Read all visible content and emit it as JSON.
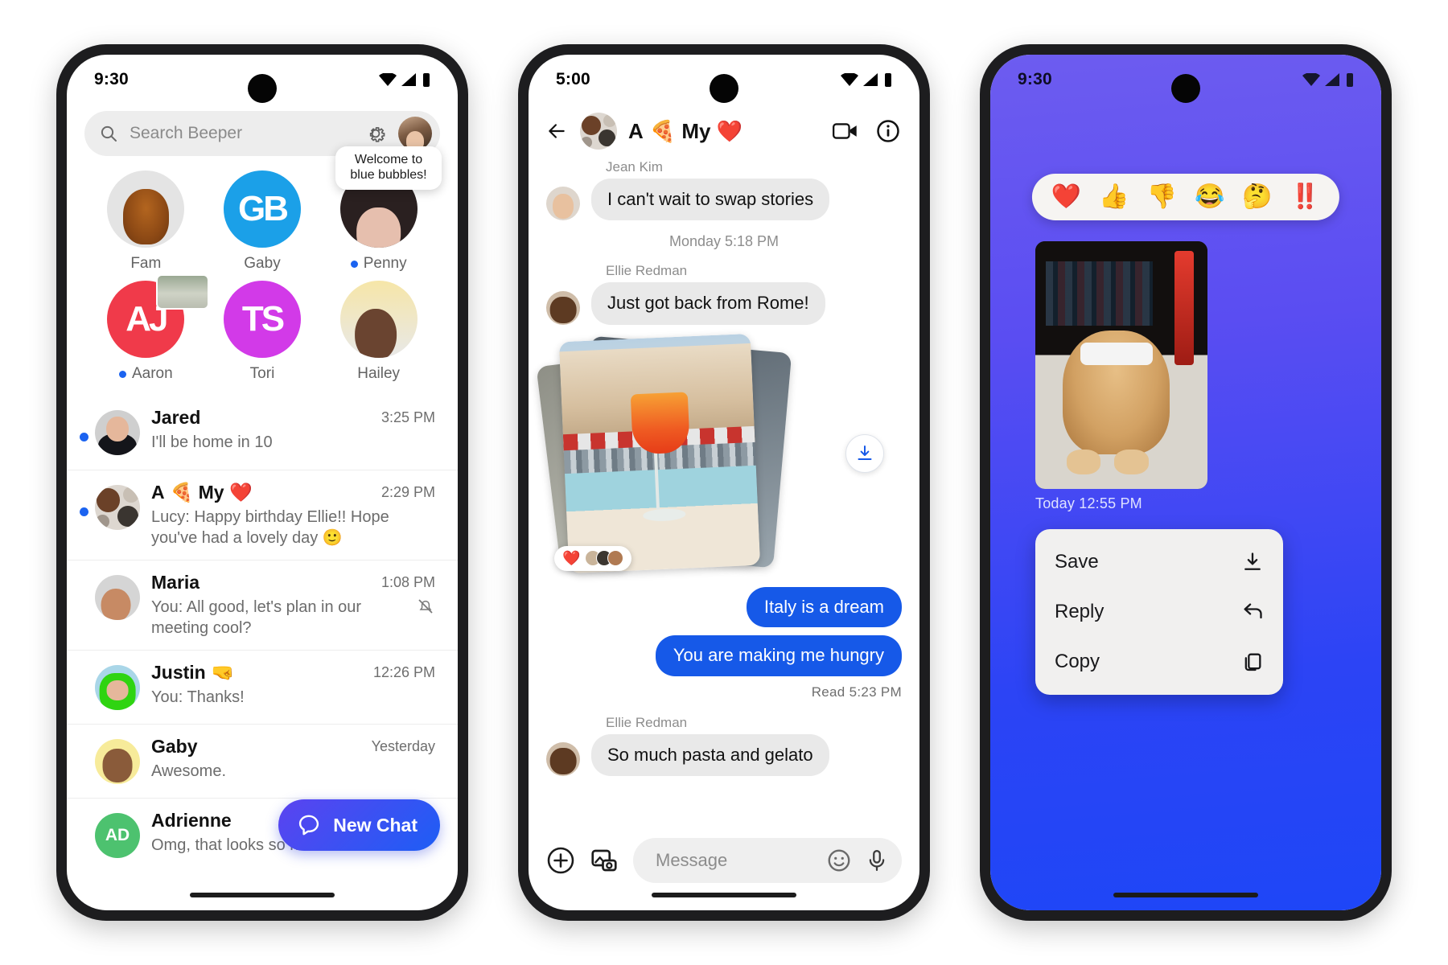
{
  "phone1": {
    "status": {
      "time": "9:30",
      "icons": [
        "wifi-icon",
        "cellular-icon",
        "battery-icon"
      ]
    },
    "search": {
      "placeholder": "Search Beeper",
      "gear_icon": "gear-icon",
      "avatar": "me-avatar"
    },
    "pinned": [
      {
        "label": "Fam",
        "unread": false,
        "kind": "photo"
      },
      {
        "label": "Gaby",
        "unread": false,
        "kind": "monogram",
        "monogram": "GB",
        "color": "#1ba0e8"
      },
      {
        "label": "Penny",
        "unread": true,
        "kind": "photo"
      },
      {
        "label": "Aaron",
        "unread": true,
        "kind": "monogram",
        "monogram": "AJ",
        "color": "#f03a4a"
      },
      {
        "label": "Tori",
        "unread": false,
        "kind": "monogram",
        "monogram": "TS",
        "color": "#d23ae8"
      },
      {
        "label": "Hailey",
        "unread": false,
        "kind": "photo"
      }
    ],
    "tooltip": "Welcome to blue bubbles!",
    "chats": [
      {
        "name": "Jared",
        "emoji": "",
        "time": "3:25 PM",
        "preview": "I'll be home in 10",
        "unread": true,
        "muted": false
      },
      {
        "name": "A",
        "emoji": "🍕 My ❤️",
        "time": "2:29 PM",
        "preview": "Lucy: Happy birthday Ellie!! Hope you've had a lovely day  🙂",
        "unread": true,
        "muted": false
      },
      {
        "name": "Maria",
        "emoji": "",
        "time": "1:08 PM",
        "preview": "You: All good, let's plan in our meeting cool?",
        "unread": false,
        "muted": true
      },
      {
        "name": "Justin",
        "emoji": "🤜",
        "time": "12:26 PM",
        "preview": "You: Thanks!",
        "unread": false,
        "muted": false
      },
      {
        "name": "Gaby",
        "emoji": "",
        "time": "Yesterday",
        "preview": "Awesome.",
        "unread": false,
        "muted": false
      },
      {
        "name": "Adrienne",
        "emoji": "",
        "time": "",
        "preview": "Omg, that looks so nice!",
        "unread": false,
        "muted": false,
        "initials": "AD"
      }
    ],
    "fab": {
      "label": "New Chat",
      "icon": "chat-bubble-icon"
    }
  },
  "phone2": {
    "status": {
      "time": "5:00"
    },
    "header": {
      "back_icon": "back-arrow-icon",
      "title": "A",
      "title_emoji": "🍕 My ❤️",
      "video_icon": "video-call-icon",
      "info_icon": "info-icon"
    },
    "messages": [
      {
        "type": "in",
        "sender": "Jean Kim",
        "text": "I can't wait to swap stories"
      },
      {
        "type": "divider",
        "text": "Monday 5:18 PM"
      },
      {
        "type": "in",
        "sender": "Ellie Redman",
        "text": "Just got back from Rome!"
      },
      {
        "type": "photos",
        "reaction": "❤️",
        "download_icon": "download-icon"
      },
      {
        "type": "out",
        "text": "Italy is a dream"
      },
      {
        "type": "out",
        "text": "You are making me hungry"
      },
      {
        "type": "receipt",
        "text": "Read  5:23 PM"
      },
      {
        "type": "in",
        "sender": "Ellie Redman",
        "text": "So much pasta and gelato"
      }
    ],
    "composer": {
      "plus_icon": "plus-circle-icon",
      "gallery_icon": "gallery-camera-icon",
      "placeholder": "Message",
      "emoji_icon": "emoji-icon",
      "mic_icon": "microphone-icon"
    }
  },
  "phone3": {
    "status": {
      "time": "9:30"
    },
    "background_color": "#3f47f5",
    "reactions": [
      "❤️",
      "👍",
      "👎",
      "😂",
      "🤔",
      "‼️"
    ],
    "media": {
      "timestamp": "Today  12:55 PM",
      "alt": "dog-with-sunglasses-photo"
    },
    "menu": [
      {
        "label": "Save",
        "icon": "download-icon"
      },
      {
        "label": "Reply",
        "icon": "reply-arrow-icon"
      },
      {
        "label": "Copy",
        "icon": "copy-icon"
      }
    ]
  }
}
